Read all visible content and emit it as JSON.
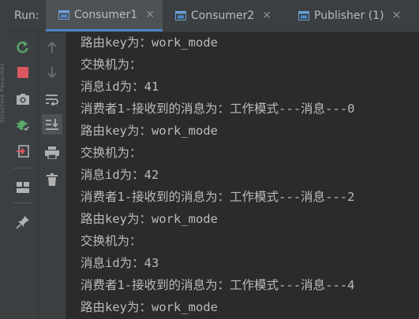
{
  "run_label": "Run:",
  "tabs": [
    {
      "label": "Consumer1",
      "active": true
    },
    {
      "label": "Consumer2",
      "active": false
    },
    {
      "label": "Publisher (1)",
      "active": false
    }
  ],
  "tab_close_glyph": "✕",
  "side_text": "Structure  Favorites",
  "colors": {
    "background": "#2b2b2b",
    "panel": "#3c3f41",
    "text": "#bbbbbb",
    "rerun_green": "#59a869",
    "stop_red": "#db5860",
    "active_tab_underline": "#4a88c7"
  },
  "icons": {
    "toolbar_a": [
      "rerun-icon",
      "stop-icon",
      "camera-icon",
      "debug-bug-icon",
      "exit-icon",
      "layout-icon",
      "pin-icon"
    ],
    "toolbar_b": [
      "up-arrow-icon",
      "down-arrow-icon",
      "soft-wrap-icon",
      "scroll-to-end-icon",
      "print-icon",
      "trash-icon"
    ]
  },
  "console_lines": [
    "路由key为：work_mode",
    "交换机为：",
    "消息id为：41",
    "消费者1-接收到的消息为：工作模式---消息---0",
    "路由key为：work_mode",
    "交换机为：",
    "消息id为：42",
    "消费者1-接收到的消息为：工作模式---消息---2",
    "路由key为：work_mode",
    "交换机为：",
    "消息id为：43",
    "消费者1-接收到的消息为：工作模式---消息---4",
    "路由key为：work_mode"
  ]
}
